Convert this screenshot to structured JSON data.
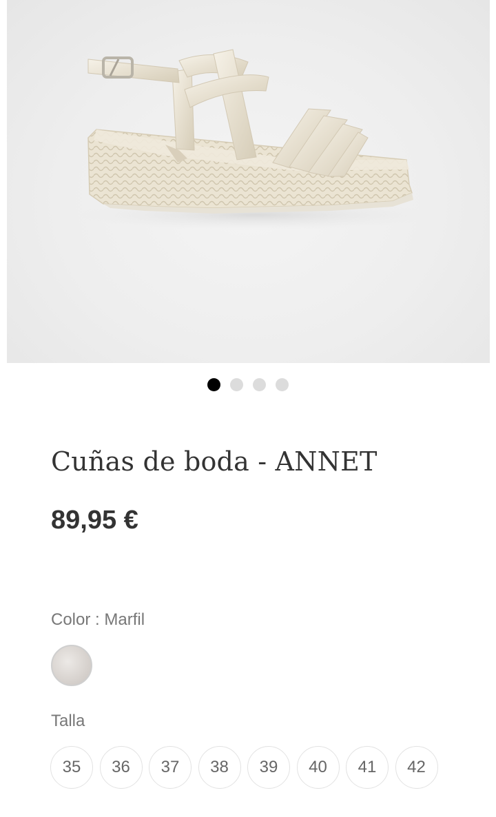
{
  "gallery": {
    "image_alt": "Cuñas de boda - ANNET",
    "slide_count": 4,
    "active_index": 0
  },
  "product": {
    "title": "Cuñas de boda - ANNET",
    "price": "89,95 €"
  },
  "color": {
    "label": "Color : Marfil",
    "swatch_name": "Marfil",
    "swatch_color": "#d9d4d0"
  },
  "size": {
    "label": "Talla",
    "options": [
      "35",
      "36",
      "37",
      "38",
      "39",
      "40",
      "41",
      "42"
    ]
  }
}
